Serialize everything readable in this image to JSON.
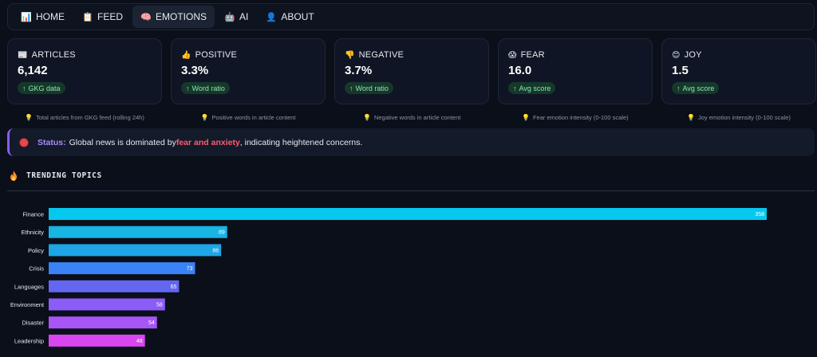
{
  "nav": {
    "items": [
      {
        "icon": "chart-icon",
        "glyph": "📊",
        "label": "HOME",
        "active": false
      },
      {
        "icon": "note-icon",
        "glyph": "📋",
        "label": "FEED",
        "active": false
      },
      {
        "icon": "brain-icon",
        "glyph": "🧠",
        "label": "EMOTIONS",
        "active": true
      },
      {
        "icon": "robot-icon",
        "glyph": "🤖",
        "label": "AI",
        "active": false
      },
      {
        "icon": "user-icon",
        "glyph": "👤",
        "label": "ABOUT",
        "active": false
      }
    ]
  },
  "cards": [
    {
      "icon": "newspaper-icon",
      "glyph": "📰",
      "label": "ARTICLES",
      "value": "6,142",
      "badge": "GKG data",
      "hint": "Total articles from GKG feed (rolling 24h)"
    },
    {
      "icon": "thumbs-up-icon",
      "glyph": "👍",
      "label": "POSITIVE",
      "value": "3.3%",
      "badge": "Word ratio",
      "hint": "Positive words in article content"
    },
    {
      "icon": "thumbs-down-icon",
      "glyph": "👎",
      "label": "NEGATIVE",
      "value": "3.7%",
      "badge": "Word ratio",
      "hint": "Negative words in article content"
    },
    {
      "icon": "fear-face-icon",
      "glyph": "😱",
      "label": "FEAR",
      "value": "16.0",
      "badge": "Avg score",
      "hint": "Fear emotion intensity (0-100 scale)"
    },
    {
      "icon": "joy-face-icon",
      "glyph": "😊",
      "label": "JOY",
      "value": "1.5",
      "badge": "Avg score",
      "hint": "Joy emotion intensity (0-100 scale)"
    }
  ],
  "badge_arrow": "↑",
  "status": {
    "label": "Status:",
    "text_before": "Global news is dominated by ",
    "highlight": "fear and anxiety",
    "text_after": ", indicating heightened concerns."
  },
  "trending": {
    "title": "TRENDING TOPICS"
  },
  "chart_data": {
    "type": "bar",
    "orientation": "horizontal",
    "title": "",
    "xlabel": "",
    "ylabel": "",
    "categories": [
      "Finance",
      "Ethnicity",
      "Policy",
      "Crisis",
      "Languages",
      "Environment",
      "Disaster",
      "Leadership"
    ],
    "values": [
      358,
      89,
      86,
      73,
      65,
      58,
      54,
      48
    ],
    "colors": [
      "#06c8ee",
      "#17b4e4",
      "#1ea6e6",
      "#3b82f6",
      "#6366f1",
      "#8b5cf6",
      "#a855f7",
      "#d946ef"
    ],
    "xlim": [
      0,
      358
    ],
    "grid": false,
    "legend": "none",
    "data_labels": true
  }
}
